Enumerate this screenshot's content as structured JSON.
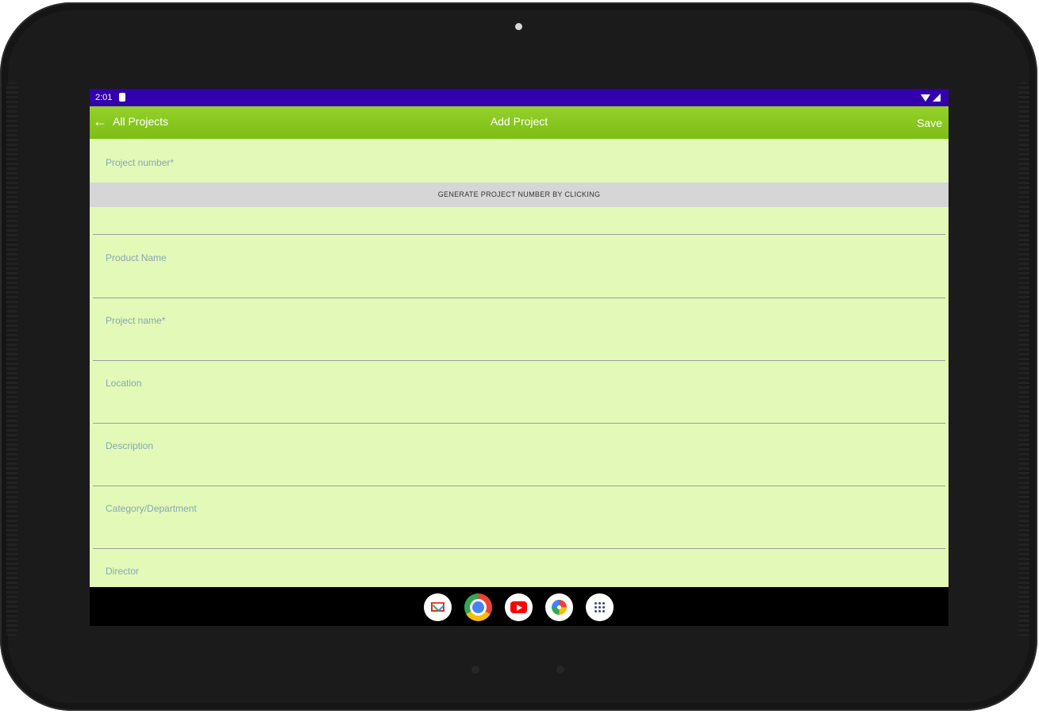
{
  "status_bar": {
    "time": "2:01"
  },
  "app_bar": {
    "back_label": "All Projects",
    "title": "Add Project",
    "save_label": "Save"
  },
  "form": {
    "project_number_label": "Project number*",
    "generate_button_label": "GENERATE PROJECT NUMBER BY CLICKING",
    "fields": [
      {
        "label": "Product Name"
      },
      {
        "label": "Project name*"
      },
      {
        "label": "Location"
      },
      {
        "label": "Description"
      },
      {
        "label": "Category/Department"
      },
      {
        "label": "Director"
      }
    ]
  },
  "dock": {
    "apps": [
      "gmail-icon",
      "chrome-icon",
      "youtube-icon",
      "photos-icon",
      "app-drawer-icon"
    ]
  },
  "colors": {
    "status_bar": "#3200ad",
    "app_bar": "#8cc920",
    "form_background": "#e2f9b8",
    "generate_button": "#d6d6d6",
    "label_text": "#8aa6b4"
  }
}
